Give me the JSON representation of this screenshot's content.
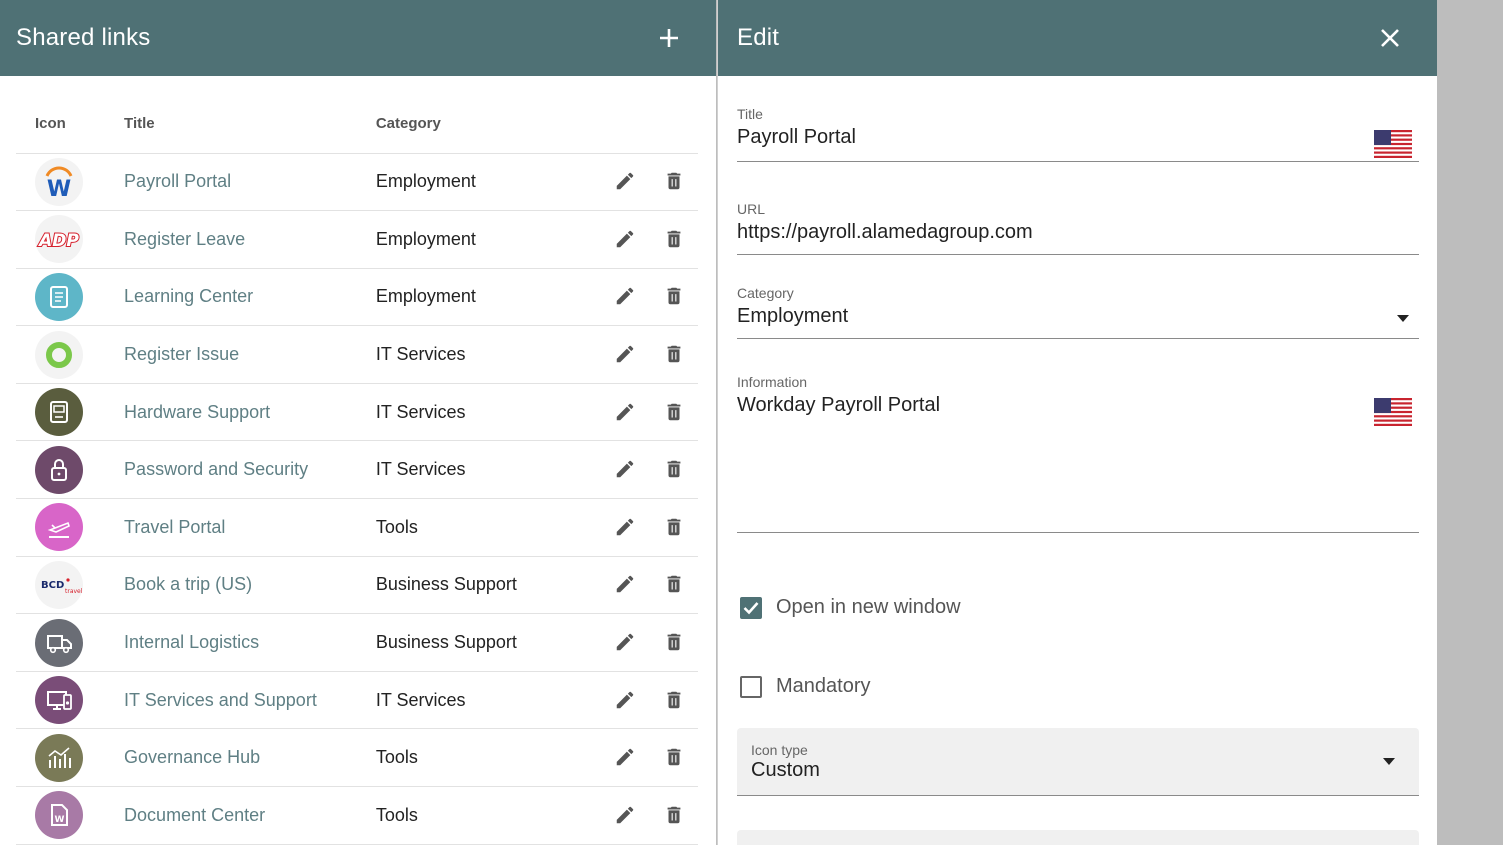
{
  "left": {
    "title": "Shared links",
    "add_icon": "plus-icon",
    "columns": {
      "icon": "Icon",
      "title": "Title",
      "category": "Category"
    },
    "rows": [
      {
        "title": "Payroll Portal",
        "category": "Employment",
        "icon": "workday-logo",
        "bg": "#f3f3f3"
      },
      {
        "title": "Register Leave",
        "category": "Employment",
        "icon": "adp-logo",
        "bg": "#f3f3f3"
      },
      {
        "title": "Learning Center",
        "category": "Employment",
        "icon": "book-icon",
        "bg": "#5eb6c8"
      },
      {
        "title": "Register Issue",
        "category": "IT Services",
        "icon": "ring-logo",
        "bg": "#f3f3f3"
      },
      {
        "title": "Hardware Support",
        "category": "IT Services",
        "icon": "device-icon",
        "bg": "#5a5d3e"
      },
      {
        "title": "Password and Security",
        "category": "IT Services",
        "icon": "lock-icon",
        "bg": "#6e4a6a"
      },
      {
        "title": "Travel Portal",
        "category": "Tools",
        "icon": "plane-icon",
        "bg": "#d865c8"
      },
      {
        "title": "Book a trip (US)",
        "category": "Business Support",
        "icon": "bcd-travel-logo",
        "bg": "#f3f3f3"
      },
      {
        "title": "Internal Logistics",
        "category": "Business Support",
        "icon": "truck-icon",
        "bg": "#6a6d75"
      },
      {
        "title": "IT Services and Support",
        "category": "IT Services",
        "icon": "monitor-icon",
        "bg": "#7a4d78"
      },
      {
        "title": "Governance Hub",
        "category": "Tools",
        "icon": "chart-icon",
        "bg": "#7a7a57"
      },
      {
        "title": "Document Center",
        "category": "Tools",
        "icon": "word-doc-icon",
        "bg": "#a87aa6"
      }
    ]
  },
  "edit": {
    "title": "Edit",
    "close_icon": "close-icon",
    "title_label": "Title",
    "title_value": "Payroll Portal",
    "url_label": "URL",
    "url_value": "https://payroll.alamedagroup.com",
    "category_label": "Category",
    "category_value": "Employment",
    "info_label": "Information",
    "info_value": "Workday Payroll Portal",
    "open_new_window": "Open in new window",
    "open_new_window_checked": true,
    "mandatory": "Mandatory",
    "mandatory_checked": false,
    "icon_type_label": "Icon type",
    "icon_type_value": "Custom"
  },
  "colors": {
    "header": "#4f7175",
    "link_text": "#5f7f84"
  }
}
